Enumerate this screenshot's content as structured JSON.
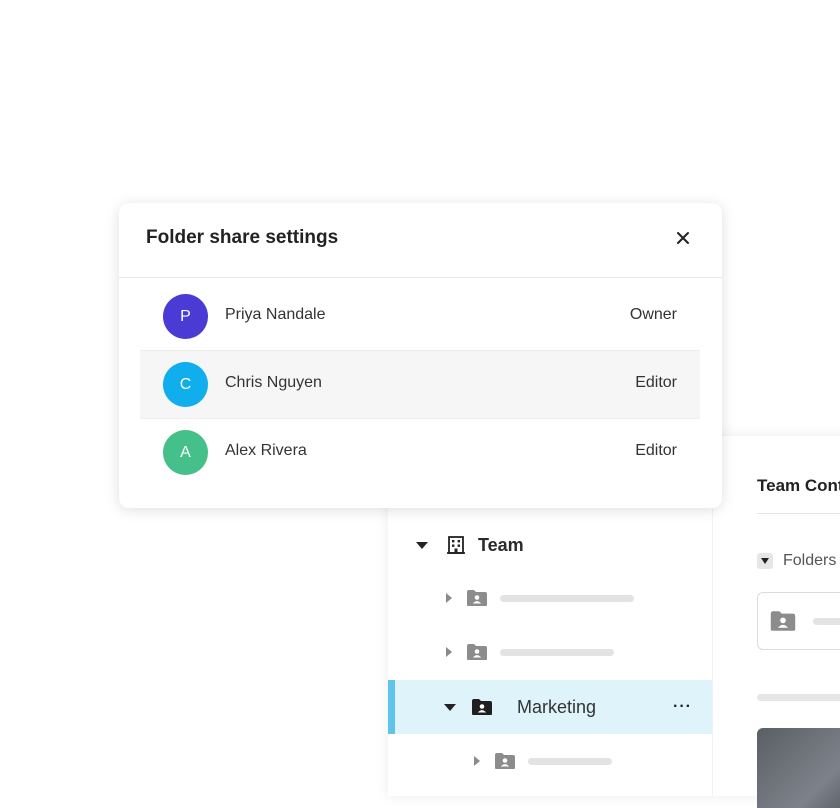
{
  "modal": {
    "title": "Folder share settings",
    "close_icon": "close-icon",
    "members": [
      {
        "initial": "P",
        "name": "Priya Nandale",
        "role": "Owner",
        "avatar_color": "#4a3bd4"
      },
      {
        "initial": "C",
        "name": "Chris Nguyen",
        "role": "Editor",
        "avatar_color": "#10aeed"
      },
      {
        "initial": "A",
        "name": "Alex Rivera",
        "role": "Editor",
        "avatar_color": "#46c08a"
      }
    ]
  },
  "tree": {
    "root_label": "Team",
    "root_icon": "building-icon",
    "selected_label": "Marketing",
    "folder_icon": "shared-folder-icon",
    "more_icon": "more-icon",
    "more_glyph": "···",
    "selected_accent": "#5ec4ec",
    "selected_background": "#dff3fb"
  },
  "content": {
    "title": "Team Cont",
    "folders_label": "Folders"
  }
}
